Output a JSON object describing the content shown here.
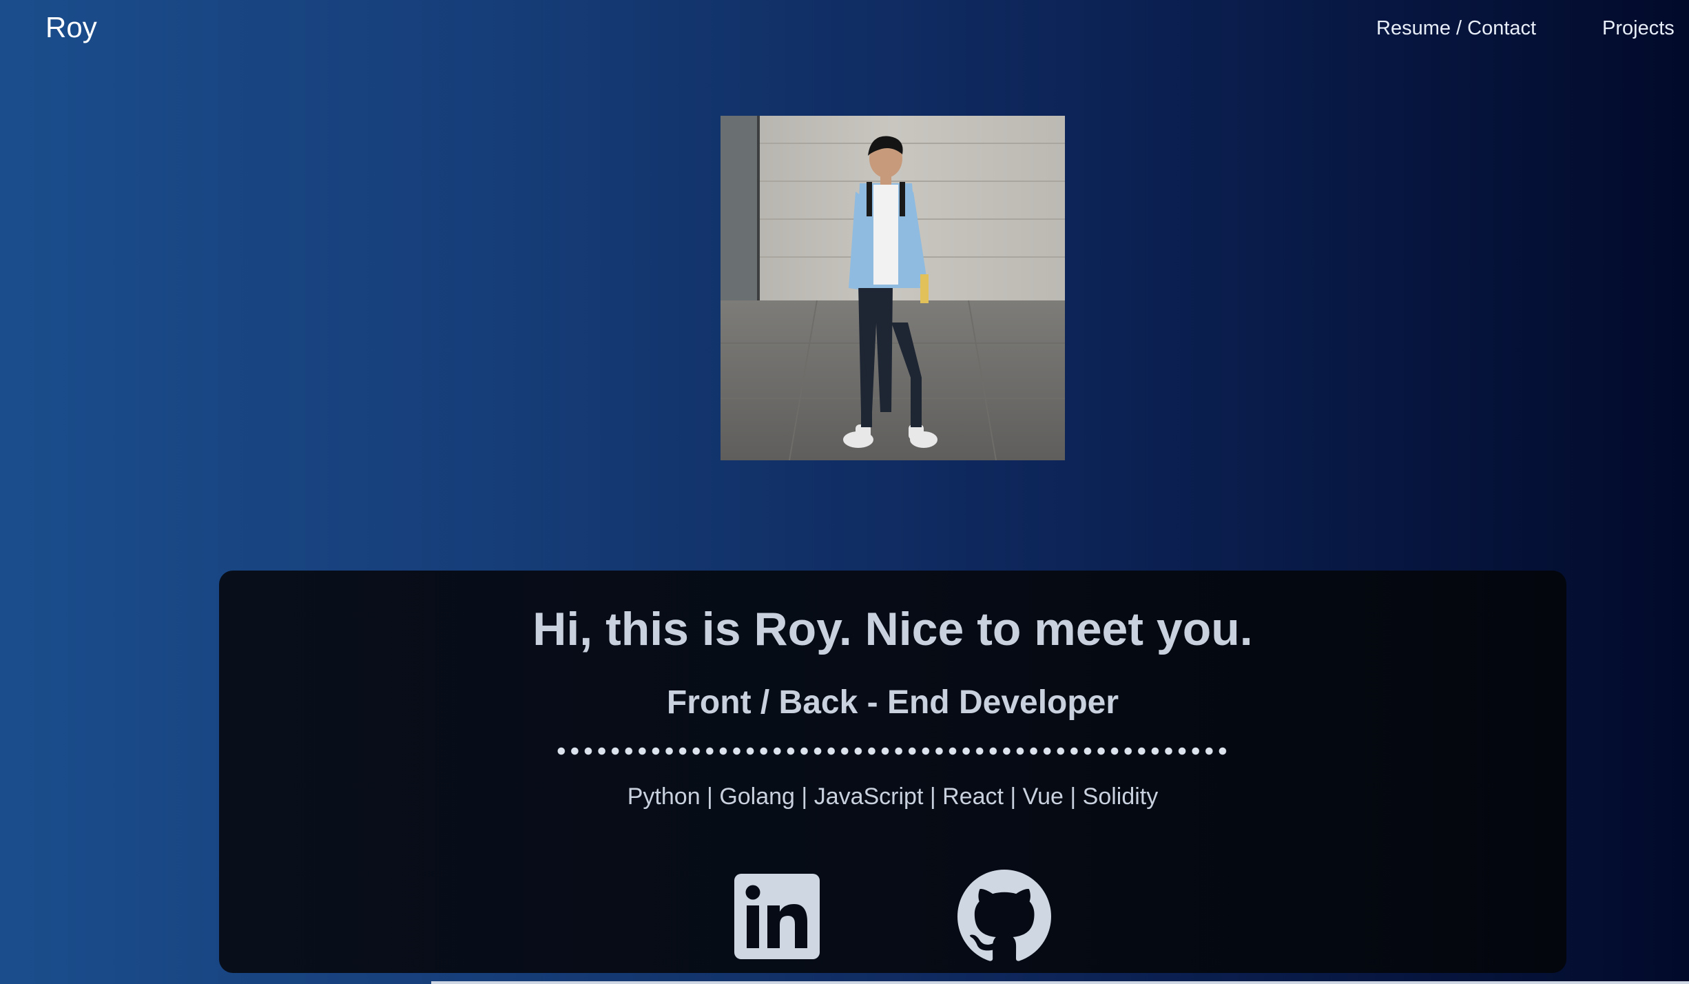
{
  "header": {
    "brand": "Roy",
    "nav": [
      {
        "label": "Resume / Contact"
      },
      {
        "label": "Projects"
      }
    ]
  },
  "hero": {
    "photo_alt": "Photo of Roy",
    "greeting": "Hi, this is Roy. Nice to meet you.",
    "role": "Front / Back - End Developer",
    "skills": "Python | Golang | JavaScript | React | Vue | Solidity",
    "social": [
      {
        "icon": "linkedin-icon"
      },
      {
        "icon": "github-icon"
      }
    ]
  },
  "colors": {
    "background_left": "#1b4d8c",
    "background_right": "#020a2a",
    "card": "#060b15",
    "text": "#c9d1de"
  }
}
